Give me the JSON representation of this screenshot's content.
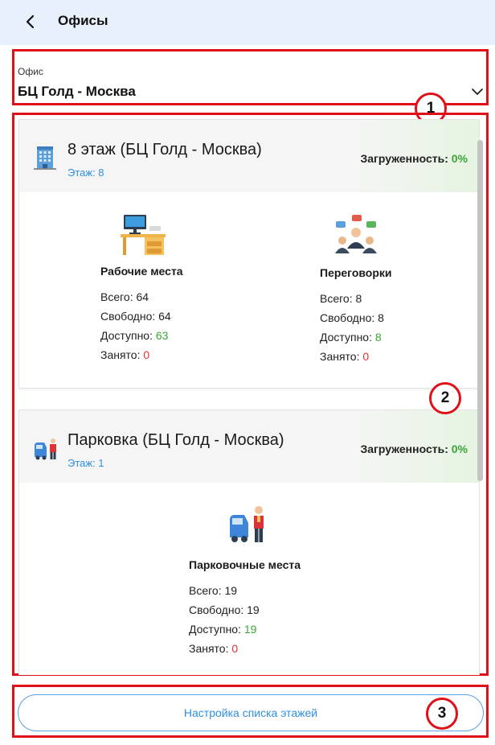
{
  "header": {
    "title": "Офисы"
  },
  "office_select": {
    "label": "Офис",
    "value": "БЦ Голд - Москва"
  },
  "annotations": [
    "1",
    "2",
    "3"
  ],
  "floors": [
    {
      "title": "8 этаж (БЦ Голд - Москва)",
      "floor": "Этаж: 8",
      "load_label": "Загруженность:",
      "load_value": "0%",
      "blocks": [
        {
          "title": "Рабочие места",
          "total_label": "Всего:",
          "total": "64",
          "free_label": "Свободно:",
          "free": "64",
          "available_label": "Доступно:",
          "available": "63",
          "busy_label": "Занято:",
          "busy": "0"
        },
        {
          "title": "Переговорки",
          "total_label": "Всего:",
          "total": "8",
          "free_label": "Свободно:",
          "free": "8",
          "available_label": "Доступно:",
          "available": "8",
          "busy_label": "Занято:",
          "busy": "0"
        }
      ]
    },
    {
      "title": "Парковка (БЦ Голд - Москва)",
      "floor": "Этаж: 1",
      "load_label": "Загруженность:",
      "load_value": "0%",
      "blocks": [
        {
          "title": "Парковочные места",
          "total_label": "Всего:",
          "total": "19",
          "free_label": "Свободно:",
          "free": "19",
          "available_label": "Доступно:",
          "available": "19",
          "busy_label": "Занято:",
          "busy": "0"
        }
      ]
    }
  ],
  "footer": {
    "button_label": "Настройка списка этажей"
  },
  "colors": {
    "accent": "#2f8fe0",
    "green": "#3aa635",
    "red": "#e03434",
    "annotation": "#e0101a"
  }
}
